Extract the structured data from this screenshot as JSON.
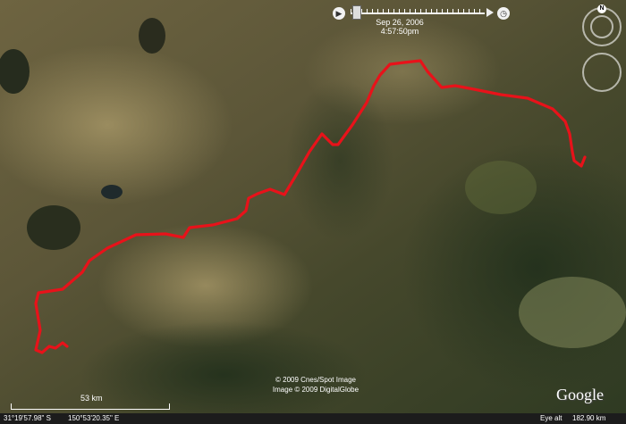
{
  "time_slider": {
    "date": "Sep 26, 2006",
    "time": "4:57:50pm"
  },
  "navigation": {
    "north_label": "N"
  },
  "scale": {
    "label": "53 km"
  },
  "credits": {
    "line1": "© 2009 Cnes/Spot Image",
    "line2": "Image © 2009 DigitalGlobe"
  },
  "logo": {
    "text": "Google"
  },
  "status_bar": {
    "latitude": "31°19'57.98\" S",
    "longitude": "150°53'20.35\" E",
    "eye_alt_label": "Eye alt",
    "eye_alt_value": "182.90 km"
  },
  "colors": {
    "track": "#e8121a",
    "terrain_dark": "#3b3f22",
    "terrain_light": "#8a7a55"
  },
  "icons": [
    "play-icon",
    "slider-thumb-icon",
    "forward-icon",
    "compass-icon",
    "look-ring-icon"
  ]
}
